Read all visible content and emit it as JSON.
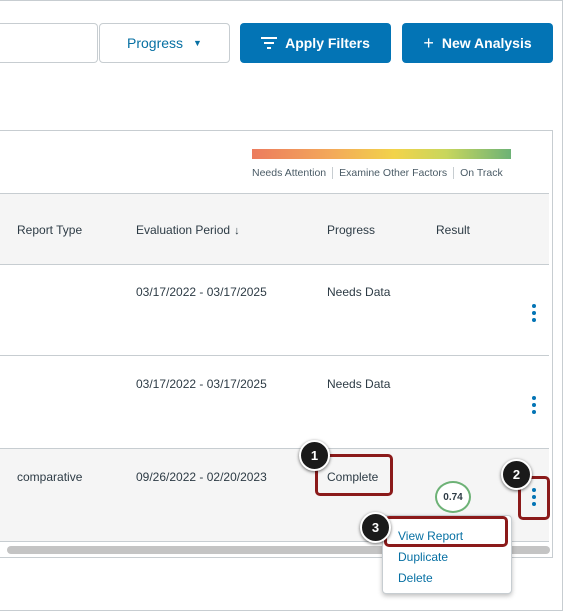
{
  "toolbar": {
    "progress_label": "Progress",
    "apply_filters_label": "Apply Filters",
    "new_analysis_label": "New Analysis"
  },
  "legend": {
    "needs_attention": "Needs Attention",
    "examine_other": "Examine Other Factors",
    "on_track": "On Track"
  },
  "table": {
    "headers": {
      "report_type": "Report Type",
      "evaluation_period": "Evaluation Period",
      "progress": "Progress",
      "result": "Result"
    },
    "rows": [
      {
        "report_type": "",
        "evaluation_period": "03/17/2022 - 03/17/2025",
        "progress": "Needs Data",
        "result": ""
      },
      {
        "report_type": "",
        "evaluation_period": "03/17/2022 - 03/17/2025",
        "progress": "Needs Data",
        "result": ""
      },
      {
        "report_type": "comparative",
        "evaluation_period": "09/26/2022 - 02/20/2023",
        "progress": "Complete",
        "result": "0.74"
      }
    ]
  },
  "menu": {
    "view_report": "View Report",
    "duplicate": "Duplicate",
    "delete": "Delete"
  },
  "annotations": {
    "marker_1": "1",
    "marker_2": "2",
    "marker_3": "3"
  },
  "colors": {
    "primary": "#0374b5",
    "link": "#0770a3",
    "annotation": "#8b1a1a",
    "result_ring": "#6db276"
  }
}
